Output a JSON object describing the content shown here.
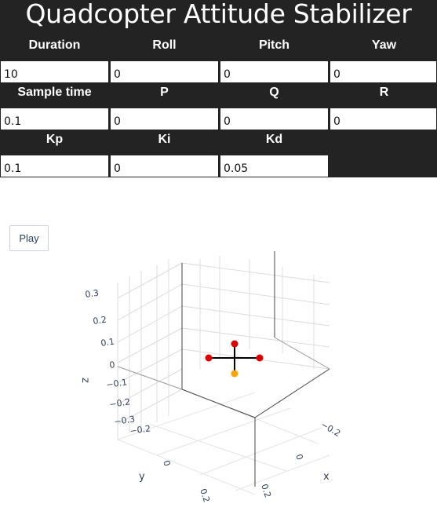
{
  "title": "Quadcopter Attitude Stabilizer",
  "labels": {
    "duration": "Duration",
    "roll": "Roll",
    "pitch": "Pitch",
    "yaw": "Yaw",
    "sample_time": "Sample time",
    "p": "P",
    "q": "Q",
    "r": "R",
    "kp": "Kp",
    "ki": "Ki",
    "kd": "Kd"
  },
  "values": {
    "duration": "10",
    "roll": "0",
    "pitch": "0",
    "yaw": "0",
    "sample_time": "0.1",
    "p": "0",
    "q": "0",
    "r": "0",
    "kp": "0.1",
    "ki": "0",
    "kd": "0.05"
  },
  "play_label": "Play",
  "plot": {
    "z_ticks": [
      "0.3",
      "0.2",
      "0.1",
      "0",
      "−0.1",
      "−0.2",
      "−0.3"
    ],
    "y_ticks": [
      "−0.2",
      "0",
      "0.2"
    ],
    "x_ticks": [
      "−0.2",
      "0",
      "0.2"
    ],
    "axis_titles": {
      "x": "x",
      "y": "y",
      "z": "z"
    },
    "marker_colors": {
      "rotor": "#e00000",
      "bottom": "#ffa500",
      "arm": "#000000"
    }
  }
}
